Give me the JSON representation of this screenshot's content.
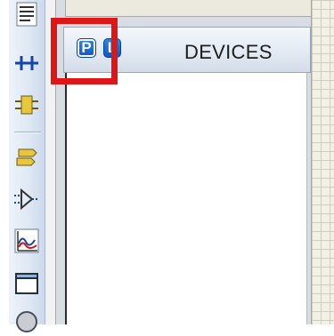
{
  "devices_panel": {
    "title": "DEVICES",
    "pick_button_label": "P",
    "library_button_label": "L",
    "accent_color": "#1565d8",
    "highlight_color": "#e01616"
  },
  "toolbar": {
    "tools": [
      {
        "icon": "text-script-icon"
      },
      {
        "icon": "bus-icon"
      },
      {
        "icon": "subcircuit-icon"
      },
      {
        "icon": "terminal-icon"
      },
      {
        "icon": "device-pin-icon"
      },
      {
        "icon": "graph-icon"
      },
      {
        "icon": "tape-recorder-icon"
      },
      {
        "icon": "generator-icon"
      }
    ]
  }
}
